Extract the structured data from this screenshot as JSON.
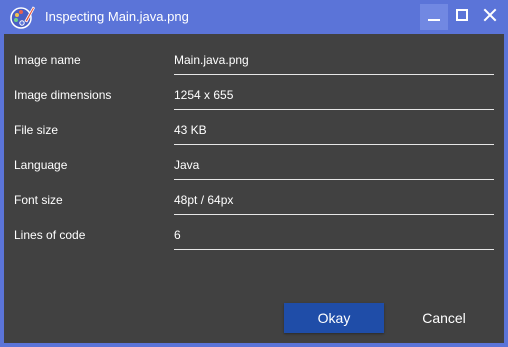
{
  "window": {
    "title": "Inspecting Main.java.png",
    "accent_color": "#5b74d8",
    "app_icon": "palette-icon",
    "controls": {
      "minimize": "minimize-icon",
      "maximize": "maximize-icon",
      "close": "close-icon"
    }
  },
  "fields": [
    {
      "label": "Image name",
      "value": "Main.java.png"
    },
    {
      "label": "Image dimensions",
      "value": "1254 x 655"
    },
    {
      "label": "File size",
      "value": "43 KB"
    },
    {
      "label": "Language",
      "value": "Java"
    },
    {
      "label": "Font size",
      "value": "48pt / 64px"
    },
    {
      "label": "Lines of code",
      "value": "6"
    }
  ],
  "buttons": {
    "okay_label": "Okay",
    "cancel_label": "Cancel",
    "okay_color": "#1f4da8"
  }
}
